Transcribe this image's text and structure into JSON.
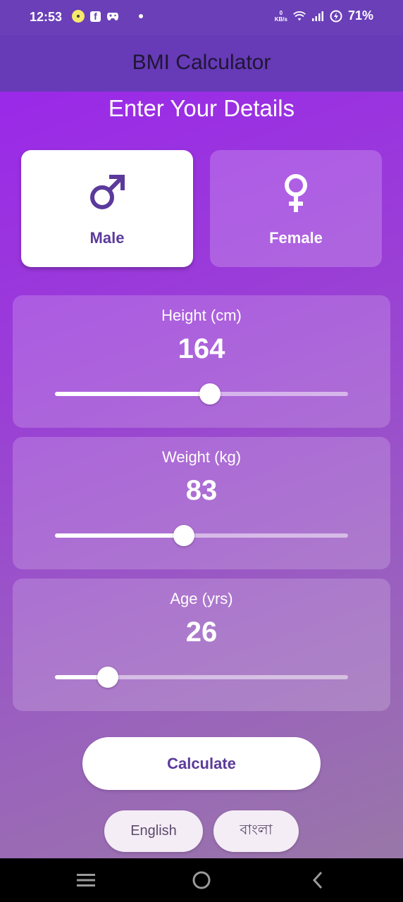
{
  "status_bar": {
    "time": "12:53",
    "network_speed_value": "0",
    "network_speed_unit": "KB/s",
    "battery": "71%",
    "icons": [
      "emoji-notification-icon",
      "facebook-icon",
      "game-controller-icon",
      "dot-icon",
      "wifi-icon",
      "signal-icon",
      "battery-charging-icon"
    ]
  },
  "app_bar": {
    "title": "BMI Calculator"
  },
  "heading": "Enter Your Details",
  "gender": {
    "male_label": "Male",
    "female_label": "Female",
    "selected": "Male"
  },
  "metrics": {
    "height": {
      "label": "Height (cm)",
      "value": "164",
      "slider_fraction": 0.53
    },
    "weight": {
      "label": "Weight (kg)",
      "value": "83",
      "slider_fraction": 0.44
    },
    "age": {
      "label": "Age (yrs)",
      "value": "26",
      "slider_fraction": 0.18
    }
  },
  "calculate_label": "Calculate",
  "languages": {
    "english": "English",
    "bangla": "বাংলা"
  },
  "nav": {
    "icons": [
      "menu-icon",
      "home-icon",
      "back-icon"
    ]
  },
  "colors": {
    "accent": "#673ab7",
    "brand_purple": "#5b3a9b",
    "background_top": "#9b22ee"
  }
}
